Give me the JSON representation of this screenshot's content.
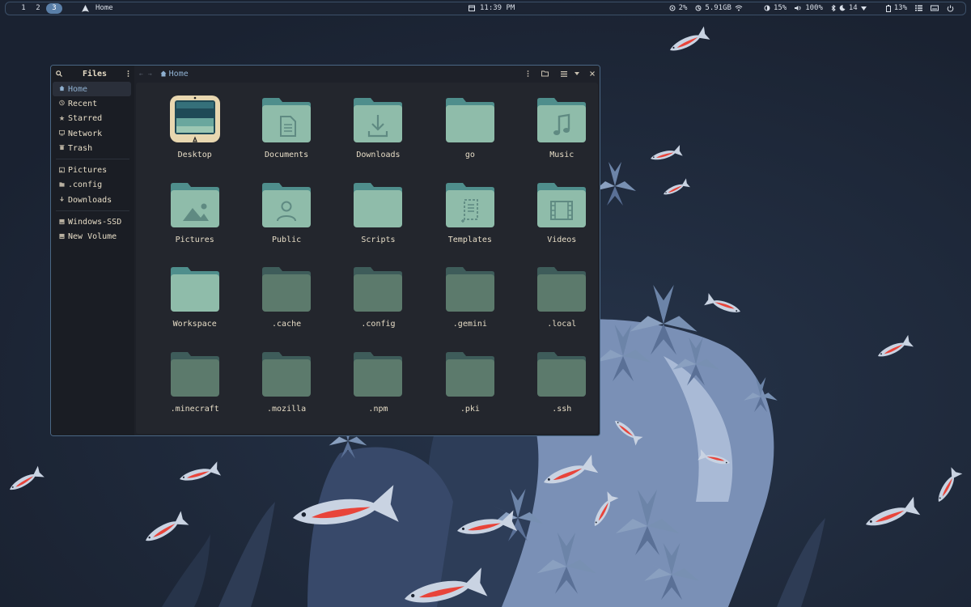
{
  "topbar": {
    "workspaces": [
      "1",
      "2",
      "3"
    ],
    "active_workspace": "3",
    "app_title": "Home",
    "clock": "11:39 PM",
    "cpu": "2%",
    "memory": "5.91GB",
    "brightness": "15%",
    "volume": "100%",
    "bluetooth_count": "14",
    "battery": "13%"
  },
  "window": {
    "sidebar_title": "Files",
    "breadcrumb": "Home",
    "sidebar": {
      "places": [
        {
          "label": "Home",
          "icon": "home-icon",
          "active": true
        },
        {
          "label": "Recent",
          "icon": "clock-icon"
        },
        {
          "label": "Starred",
          "icon": "star-icon"
        },
        {
          "label": "Network",
          "icon": "network-icon"
        },
        {
          "label": "Trash",
          "icon": "trash-icon"
        }
      ],
      "bookmarks": [
        {
          "label": "Pictures",
          "icon": "image-icon"
        },
        {
          "label": ".config",
          "icon": "folder-icon"
        },
        {
          "label": "Downloads",
          "icon": "download-icon"
        }
      ],
      "devices": [
        {
          "label": "Windows-SSD",
          "icon": "drive-icon"
        },
        {
          "label": "New Volume",
          "icon": "drive-icon"
        }
      ]
    },
    "files": [
      {
        "name": "Desktop",
        "kind": "desktop"
      },
      {
        "name": "Documents",
        "kind": "documents"
      },
      {
        "name": "Downloads",
        "kind": "downloads"
      },
      {
        "name": "go",
        "kind": "folder"
      },
      {
        "name": "Music",
        "kind": "music"
      },
      {
        "name": "Pictures",
        "kind": "pictures"
      },
      {
        "name": "Public",
        "kind": "public"
      },
      {
        "name": "Scripts",
        "kind": "folder"
      },
      {
        "name": "Templates",
        "kind": "templates"
      },
      {
        "name": "Videos",
        "kind": "videos"
      },
      {
        "name": "Workspace",
        "kind": "folder"
      },
      {
        "name": ".cache",
        "kind": "hidden"
      },
      {
        "name": ".config",
        "kind": "hidden"
      },
      {
        "name": ".gemini",
        "kind": "hidden"
      },
      {
        "name": ".local",
        "kind": "hidden"
      },
      {
        "name": ".minecraft",
        "kind": "hidden"
      },
      {
        "name": ".mozilla",
        "kind": "hidden"
      },
      {
        "name": ".npm",
        "kind": "hidden"
      },
      {
        "name": ".pki",
        "kind": "hidden"
      },
      {
        "name": ".ssh",
        "kind": "hidden"
      }
    ]
  },
  "colors": {
    "folder_back": "#4f8e8c",
    "folder_front": "#8fbcaa",
    "hidden_back": "#3e5c5a",
    "hidden_front": "#5c7a6c",
    "accent": "#8fb0d0"
  }
}
